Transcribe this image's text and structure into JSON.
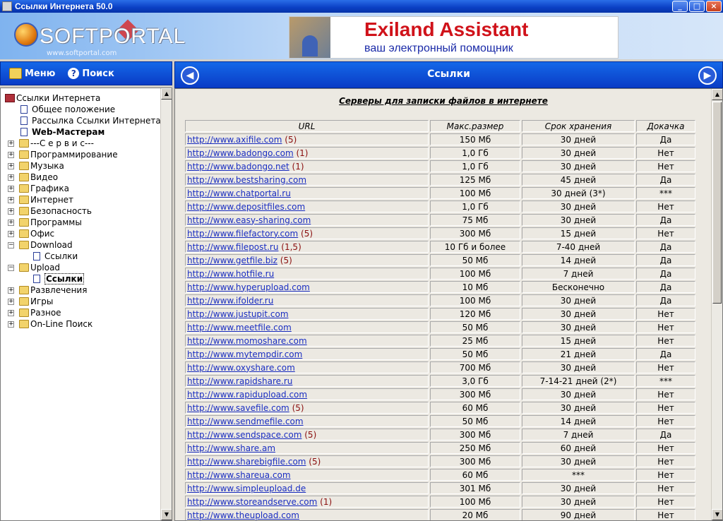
{
  "window": {
    "title": "Ссылки Интернета 50.0",
    "min": "_",
    "max": "□",
    "close": "×"
  },
  "logo": {
    "text": "SOFTPORTAL",
    "url": "www.softportal.com"
  },
  "banner": {
    "title": "Exiland Assistant",
    "subtitle": "ваш электронный помощник"
  },
  "toolbar": {
    "menu_label": "Меню",
    "search_label": "Поиск"
  },
  "header": {
    "title": "Ссылки"
  },
  "tree": [
    {
      "label": "Ссылки Интернета",
      "level": 0,
      "icon": "book",
      "exp": ""
    },
    {
      "label": "Общее положение",
      "level": 1,
      "icon": "doc",
      "exp": ""
    },
    {
      "label": "Рассылка Ссылки Интернета",
      "level": 1,
      "icon": "doc",
      "exp": ""
    },
    {
      "label": "Web-Мастерам",
      "level": 1,
      "icon": "doc",
      "exp": "",
      "bold": true
    },
    {
      "label": "---С е р в и с---",
      "level": 1,
      "icon": "folder",
      "exp": "+"
    },
    {
      "label": "Программирование",
      "level": 1,
      "icon": "folder",
      "exp": "+"
    },
    {
      "label": "Музыка",
      "level": 1,
      "icon": "folder",
      "exp": "+"
    },
    {
      "label": "Видео",
      "level": 1,
      "icon": "folder",
      "exp": "+"
    },
    {
      "label": "Графика",
      "level": 1,
      "icon": "folder",
      "exp": "+"
    },
    {
      "label": "Интернет",
      "level": 1,
      "icon": "folder",
      "exp": "+"
    },
    {
      "label": "Безопасность",
      "level": 1,
      "icon": "folder",
      "exp": "+"
    },
    {
      "label": "Программы",
      "level": 1,
      "icon": "folder",
      "exp": "+"
    },
    {
      "label": "Офис",
      "level": 1,
      "icon": "folder",
      "exp": "+"
    },
    {
      "label": "Download",
      "level": 1,
      "icon": "folder",
      "exp": "−"
    },
    {
      "label": "Ссылки",
      "level": 2,
      "icon": "doc",
      "exp": ""
    },
    {
      "label": "Upload",
      "level": 1,
      "icon": "folder",
      "exp": "−"
    },
    {
      "label": "Ссылки",
      "level": 2,
      "icon": "doc",
      "exp": "",
      "bold": true,
      "selected": true
    },
    {
      "label": "Развлечения",
      "level": 1,
      "icon": "folder",
      "exp": "+"
    },
    {
      "label": "Игры",
      "level": 1,
      "icon": "folder",
      "exp": "+"
    },
    {
      "label": "Разное",
      "level": 1,
      "icon": "folder",
      "exp": "+"
    },
    {
      "label": "On-Line Поиск",
      "level": 1,
      "icon": "folder",
      "exp": "+"
    }
  ],
  "content": {
    "caption": "Серверы для записки файлов в интернете",
    "columns": [
      "URL",
      "Макс.размер",
      "Срок хранения",
      "Докачка"
    ],
    "rows": [
      {
        "url": "http://www.axifile.com",
        "note": "(5)",
        "size": "150 Мб",
        "term": "30 дней",
        "resume": "Да"
      },
      {
        "url": "http://www.badongo.com",
        "note": "(1)",
        "size": "1,0 Гб",
        "term": "30 дней",
        "resume": "Нет"
      },
      {
        "url": "http://www.badongo.net",
        "note": "(1)",
        "size": "1,0 Гб",
        "term": "30 дней",
        "resume": "Нет"
      },
      {
        "url": "http://www.bestsharing.com",
        "note": "",
        "size": "125 Мб",
        "term": "45 дней",
        "resume": "Да"
      },
      {
        "url": "http://www.chatportal.ru",
        "note": "",
        "size": "100 Мб",
        "term": "30 дней (3*)",
        "resume": "***"
      },
      {
        "url": "http://www.depositfiles.com",
        "note": "",
        "size": "1,0 Гб",
        "term": "30 дней",
        "resume": "Нет"
      },
      {
        "url": "http://www.easy-sharing.com",
        "note": "",
        "size": "75 Мб",
        "term": "30 дней",
        "resume": "Да"
      },
      {
        "url": "http://www.filefactory.com",
        "note": "(5)",
        "size": "300 Мб",
        "term": "15 дней",
        "resume": "Нет"
      },
      {
        "url": "http://www.filepost.ru",
        "note": "(1,5)",
        "size": "10 Гб и более",
        "term": "7-40 дней",
        "resume": "Да"
      },
      {
        "url": "http://www.getfile.biz",
        "note": "(5)",
        "size": "50 Мб",
        "term": "14 дней",
        "resume": "Да"
      },
      {
        "url": "http://www.hotfile.ru",
        "note": "",
        "size": "100 Мб",
        "term": "7 дней",
        "resume": "Да"
      },
      {
        "url": "http://www.hyperupload.com",
        "note": "",
        "size": "10 Мб",
        "term": "Бесконечно",
        "resume": "Да"
      },
      {
        "url": "http://www.ifolder.ru",
        "note": "",
        "size": "100 Мб",
        "term": "30 дней",
        "resume": "Да"
      },
      {
        "url": "http://www.justupit.com",
        "note": "",
        "size": "120 Мб",
        "term": "30 дней",
        "resume": "Нет"
      },
      {
        "url": "http://www.meetfile.com",
        "note": "",
        "size": "50 Мб",
        "term": "30 дней",
        "resume": "Нет"
      },
      {
        "url": "http://www.momoshare.com",
        "note": "",
        "size": "25 Мб",
        "term": "15 дней",
        "resume": "Нет"
      },
      {
        "url": "http://www.mytempdir.com",
        "note": "",
        "size": "50 Мб",
        "term": "21 дней",
        "resume": "Да"
      },
      {
        "url": "http://www.oxyshare.com",
        "note": "",
        "size": "700 Мб",
        "term": "30 дней",
        "resume": "Нет"
      },
      {
        "url": "http://www.rapidshare.ru",
        "note": "",
        "size": "3,0 Гб",
        "term": "7-14-21 дней (2*)",
        "resume": "***"
      },
      {
        "url": "http://www.rapidupload.com",
        "note": "",
        "size": "300 Мб",
        "term": "30 дней",
        "resume": "Нет"
      },
      {
        "url": "http://www.savefile.com",
        "note": "(5)",
        "size": "60 Мб",
        "term": "30 дней",
        "resume": "Нет"
      },
      {
        "url": "http://www.sendmefile.com",
        "note": "",
        "size": "50 Мб",
        "term": "14 дней",
        "resume": "Нет"
      },
      {
        "url": "http://www.sendspace.com",
        "note": "(5)",
        "size": "300 Мб",
        "term": "7 дней",
        "resume": "Да"
      },
      {
        "url": "http://www.share.am",
        "note": "",
        "size": "250 Мб",
        "term": "60 дней",
        "resume": "Нет"
      },
      {
        "url": "http://www.sharebigfile.com",
        "note": "(5)",
        "size": "300 Мб",
        "term": "30 дней",
        "resume": "Нет"
      },
      {
        "url": "http://www.shareua.com",
        "note": "",
        "size": "60 Мб",
        "term": "***",
        "resume": "Нет"
      },
      {
        "url": "http://www.simpleupload.de",
        "note": "",
        "size": "301 Мб",
        "term": "30 дней",
        "resume": "Нет"
      },
      {
        "url": "http://www.storeandserve.com",
        "note": "(1)",
        "size": "100 Мб",
        "term": "30 дней",
        "resume": "Нет"
      },
      {
        "url": "http://www.theupload.com",
        "note": "",
        "size": "20 Мб",
        "term": "90 дней",
        "resume": "Нет"
      }
    ]
  }
}
